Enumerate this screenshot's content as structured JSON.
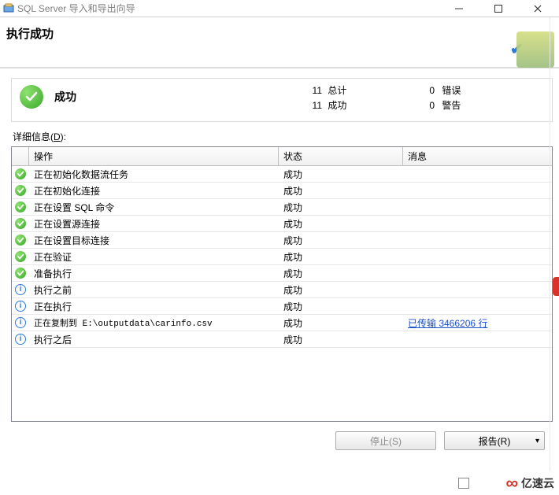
{
  "window": {
    "title": "SQL Server 导入和导出向导"
  },
  "header": {
    "title": "执行成功"
  },
  "summary": {
    "status_label": "成功",
    "total_count": "11",
    "total_label": "总计",
    "success_count": "11",
    "success_label": "成功",
    "error_count": "0",
    "error_label": "错误",
    "warning_count": "0",
    "warning_label": "警告"
  },
  "detail_label": {
    "prefix": "详细信息(",
    "accel": "D",
    "suffix": "):"
  },
  "columns": {
    "action": "操作",
    "status": "状态",
    "message": "消息"
  },
  "rows": [
    {
      "icon": "success",
      "action": "正在初始化数据流任务",
      "status": "成功",
      "message": ""
    },
    {
      "icon": "success",
      "action": "正在初始化连接",
      "status": "成功",
      "message": ""
    },
    {
      "icon": "success",
      "action": "正在设置 SQL 命令",
      "status": "成功",
      "message": ""
    },
    {
      "icon": "success",
      "action": "正在设置源连接",
      "status": "成功",
      "message": ""
    },
    {
      "icon": "success",
      "action": "正在设置目标连接",
      "status": "成功",
      "message": ""
    },
    {
      "icon": "success",
      "action": "正在验证",
      "status": "成功",
      "message": ""
    },
    {
      "icon": "success",
      "action": "准备执行",
      "status": "成功",
      "message": ""
    },
    {
      "icon": "info",
      "action": "执行之前",
      "status": "成功",
      "message": ""
    },
    {
      "icon": "info",
      "action": "正在执行",
      "status": "成功",
      "message": ""
    },
    {
      "icon": "info",
      "action": "正在复制到 E:\\outputdata\\carinfo.csv",
      "action_mono": true,
      "status": "成功",
      "message": "已传输 3466206 行",
      "message_link": true
    },
    {
      "icon": "info",
      "action": "执行之后",
      "status": "成功",
      "message": ""
    }
  ],
  "buttons": {
    "stop": "停止(S)",
    "report": "报告(R)"
  },
  "brand": "亿速云"
}
